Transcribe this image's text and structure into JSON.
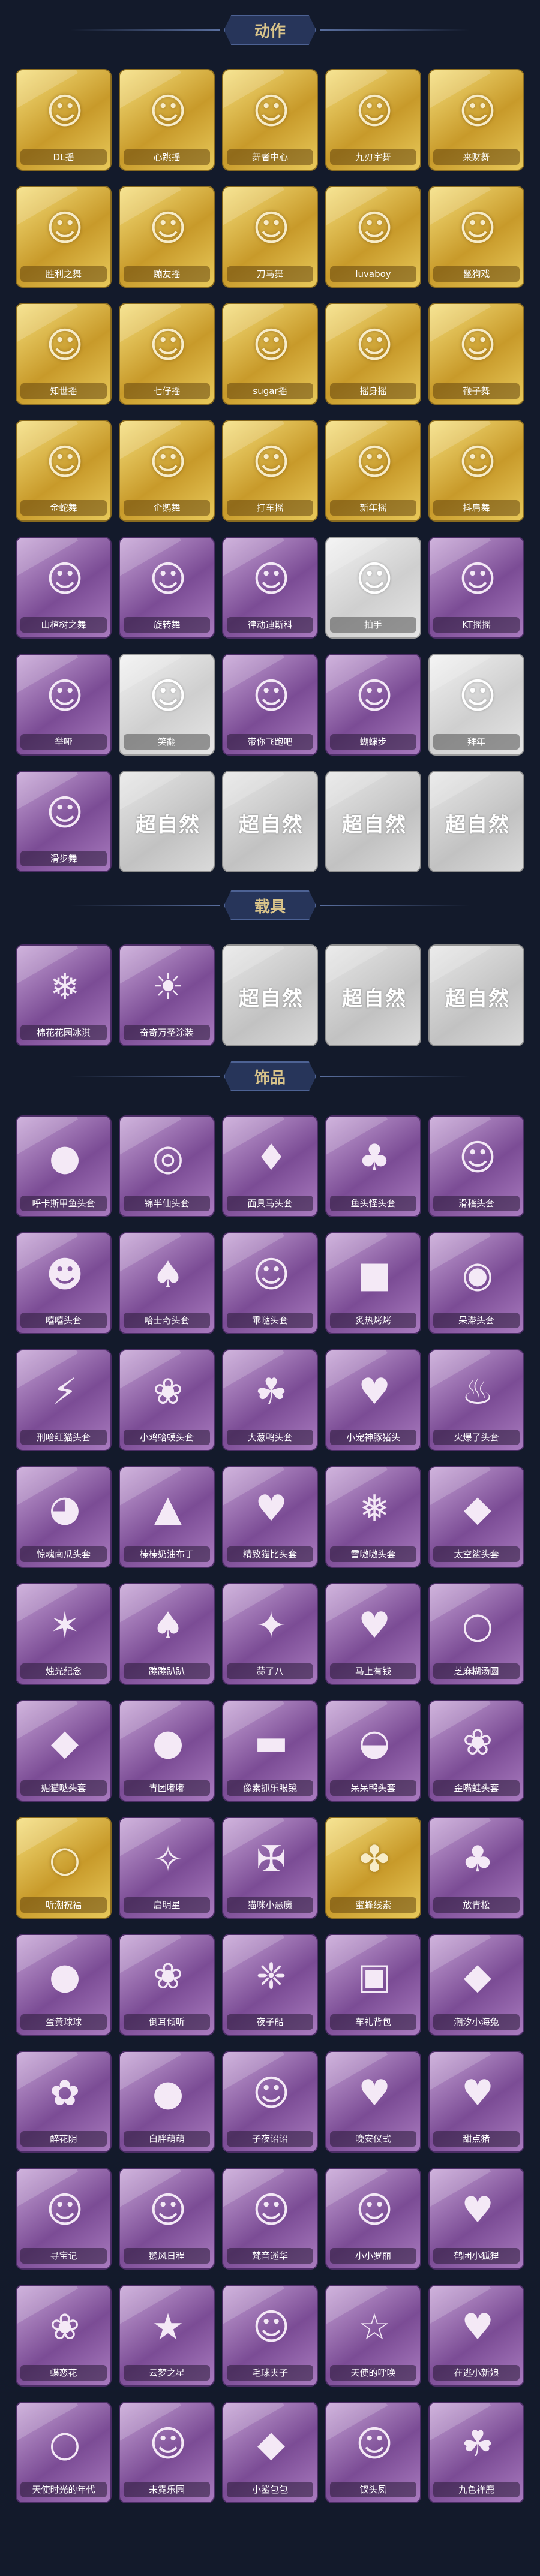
{
  "sections": [
    {
      "title": "动作",
      "items": [
        {
          "label": "DL摇",
          "style": "gold",
          "icon": "dance-pose-icon"
        },
        {
          "label": "心跳摇",
          "style": "gold",
          "icon": "dance-pose-icon"
        },
        {
          "label": "舞者中心",
          "style": "gold",
          "icon": "dance-pose-icon"
        },
        {
          "label": "九刃宇舞",
          "style": "gold",
          "icon": "dance-pose-icon"
        },
        {
          "label": "来财舞",
          "style": "gold",
          "icon": "dance-pose-icon"
        },
        {
          "label": "胜利之舞",
          "style": "gold",
          "icon": "dance-pose-icon"
        },
        {
          "label": "蹦友摇",
          "style": "gold",
          "icon": "dance-pose-icon"
        },
        {
          "label": "刀马舞",
          "style": "gold",
          "icon": "dance-pose-icon"
        },
        {
          "label": "luvaboy",
          "style": "gold",
          "icon": "dance-pose-icon"
        },
        {
          "label": "鬣狗戏",
          "style": "gold",
          "icon": "dance-pose-icon"
        },
        {
          "label": "知世摇",
          "style": "gold",
          "icon": "dance-pose-icon"
        },
        {
          "label": "七仔摇",
          "style": "gold",
          "icon": "dance-pose-icon"
        },
        {
          "label": "sugar摇",
          "style": "gold",
          "icon": "dance-pose-icon"
        },
        {
          "label": "摇身摇",
          "style": "gold",
          "icon": "dance-pose-icon"
        },
        {
          "label": "鞭子舞",
          "style": "gold",
          "icon": "dance-pose-icon"
        },
        {
          "label": "金蛇舞",
          "style": "gold",
          "icon": "dance-pose-icon"
        },
        {
          "label": "企鹅舞",
          "style": "gold",
          "icon": "dance-pose-icon"
        },
        {
          "label": "打车摇",
          "style": "gold",
          "icon": "dance-pose-icon"
        },
        {
          "label": "新年摇",
          "style": "gold",
          "icon": "dance-pose-icon"
        },
        {
          "label": "抖肩舞",
          "style": "gold",
          "icon": "dance-pose-icon"
        },
        {
          "label": "山楂树之舞",
          "style": "purple",
          "icon": "dance-pose-icon"
        },
        {
          "label": "旋转舞",
          "style": "purple",
          "icon": "dance-pose-icon"
        },
        {
          "label": "律动迪斯科",
          "style": "purple",
          "icon": "dance-pose-icon"
        },
        {
          "label": "拍手",
          "style": "gray",
          "icon": "dance-pose-icon"
        },
        {
          "label": "KT摇摇",
          "style": "purple",
          "icon": "dance-pose-icon"
        },
        {
          "label": "举哑",
          "style": "purple",
          "icon": "dance-pose-icon"
        },
        {
          "label": "笑翻",
          "style": "gray",
          "icon": "dance-pose-icon"
        },
        {
          "label": "带你飞跑吧",
          "style": "purple",
          "icon": "dance-pose-icon"
        },
        {
          "label": "蝴蝶步",
          "style": "purple",
          "icon": "dance-pose-icon"
        },
        {
          "label": "拜年",
          "style": "gray",
          "icon": "dance-pose-icon"
        },
        {
          "label": "滑步舞",
          "style": "purple",
          "icon": "dance-pose-icon"
        },
        {
          "label": "",
          "style": "placeholder",
          "icon": "logo-placeholder-icon"
        },
        {
          "label": "",
          "style": "placeholder",
          "icon": "logo-placeholder-icon"
        },
        {
          "label": "",
          "style": "placeholder",
          "icon": "logo-placeholder-icon"
        },
        {
          "label": "",
          "style": "placeholder",
          "icon": "logo-placeholder-icon"
        }
      ]
    },
    {
      "title": "载具",
      "items": [
        {
          "label": "棉花花园冰淇",
          "style": "purple",
          "icon": "ice-cream-truck-icon"
        },
        {
          "label": "奋奇万圣涂装",
          "style": "purple",
          "icon": "food-truck-icon"
        },
        {
          "label": "",
          "style": "placeholder",
          "icon": "logo-placeholder-icon"
        },
        {
          "label": "",
          "style": "placeholder",
          "icon": "logo-placeholder-icon"
        },
        {
          "label": "",
          "style": "placeholder",
          "icon": "logo-placeholder-icon"
        }
      ]
    },
    {
      "title": "饰品",
      "items": [
        {
          "label": "呼卡斯甲鱼头套",
          "style": "purple",
          "icon": "fish-head-icon"
        },
        {
          "label": "锦半仙头套",
          "style": "purple",
          "icon": "panda-head-icon"
        },
        {
          "label": "面具马头套",
          "style": "purple",
          "icon": "horse-head-icon"
        },
        {
          "label": "鱼头怪头套",
          "style": "purple",
          "icon": "fish-monster-icon"
        },
        {
          "label": "滑稽头套",
          "style": "purple",
          "icon": "smiley-icon"
        },
        {
          "label": "嘻嘻头套",
          "style": "purple",
          "icon": "grin-icon"
        },
        {
          "label": "哈士奇头套",
          "style": "purple",
          "icon": "husky-head-icon"
        },
        {
          "label": "乖哒头套",
          "style": "purple",
          "icon": "smiley-icon"
        },
        {
          "label": "炙热烤烤",
          "style": "purple",
          "icon": "monster-head-icon"
        },
        {
          "label": "呆滞头套",
          "style": "purple",
          "icon": "stare-face-icon"
        },
        {
          "label": "刑哈红猫头套",
          "style": "purple",
          "icon": "pikachu-head-icon"
        },
        {
          "label": "小鸡蛤蟆头套",
          "style": "purple",
          "icon": "frog-head-icon"
        },
        {
          "label": "大葱鸭头套",
          "style": "purple",
          "icon": "green-onion-icon"
        },
        {
          "label": "小宠神豚猪头",
          "style": "purple",
          "icon": "pig-head-icon"
        },
        {
          "label": "火爆了头套",
          "style": "purple",
          "icon": "flame-head-icon"
        },
        {
          "label": "惊魂南瓜头套",
          "style": "purple",
          "icon": "pumpkin-head-icon"
        },
        {
          "label": "榛榛奶油布丁",
          "style": "purple",
          "icon": "pudding-icon"
        },
        {
          "label": "精致猫比头套",
          "style": "purple",
          "icon": "pink-creature-icon"
        },
        {
          "label": "雪嗷嗷头套",
          "style": "purple",
          "icon": "snow-creature-icon"
        },
        {
          "label": "太空鲨头套",
          "style": "purple",
          "icon": "shark-head-icon"
        },
        {
          "label": "烛光纪念",
          "style": "purple",
          "icon": "candle-icon"
        },
        {
          "label": "蹦蹦趴趴",
          "style": "purple",
          "icon": "dog-head-icon"
        },
        {
          "label": "蒜了八",
          "style": "purple",
          "icon": "garlic-head-icon"
        },
        {
          "label": "马上有钱",
          "style": "purple",
          "icon": "pink-horse-icon"
        },
        {
          "label": "芝麻糊汤圆",
          "style": "purple",
          "icon": "dumpling-icon"
        },
        {
          "label": "媚猫哒头套",
          "style": "purple",
          "icon": "cat-head-icon"
        },
        {
          "label": "青团嘟嘟",
          "style": "purple",
          "icon": "green-bun-icon"
        },
        {
          "label": "像素抓乐眼镜",
          "style": "purple",
          "icon": "pixel-glasses-icon"
        },
        {
          "label": "呆呆鸭头套",
          "style": "purple",
          "icon": "duck-head-icon"
        },
        {
          "label": "歪嘴蛙头套",
          "style": "purple",
          "icon": "frog-head-icon"
        },
        {
          "label": "听潮祝福",
          "style": "gold",
          "icon": "halo-icon"
        },
        {
          "label": "启明星",
          "style": "purple",
          "icon": "hair-accessory-icon"
        },
        {
          "label": "猫咪小恶魔",
          "style": "purple",
          "icon": "devil-horns-icon"
        },
        {
          "label": "蜜蜂线索",
          "style": "gold",
          "icon": "bee-antenna-icon"
        },
        {
          "label": "放青松",
          "style": "purple",
          "icon": "pine-tree-icon"
        },
        {
          "label": "蛋黄球球",
          "style": "purple",
          "icon": "chick-icon"
        },
        {
          "label": "倒耳倾听",
          "style": "purple",
          "icon": "bunny-ear-icon"
        },
        {
          "label": "夜子船",
          "style": "purple",
          "icon": "crystal-icon"
        },
        {
          "label": "车礼背包",
          "style": "purple",
          "icon": "backpack-icon"
        },
        {
          "label": "潮汐小海兔",
          "style": "purple",
          "icon": "blue-cat-icon"
        },
        {
          "label": "醉花阴",
          "style": "purple",
          "icon": "flower-crown-icon"
        },
        {
          "label": "白胖萌萌",
          "style": "purple",
          "icon": "white-plush-icon"
        },
        {
          "label": "子夜诏诏",
          "style": "purple",
          "icon": "doll-icon"
        },
        {
          "label": "晚安仪式",
          "style": "purple",
          "icon": "pig-plush-icon"
        },
        {
          "label": "甜点猪",
          "style": "purple",
          "icon": "pink-bear-icon"
        },
        {
          "label": "寻宝记",
          "style": "purple",
          "icon": "pink-doll-icon"
        },
        {
          "label": "鹅风日程",
          "style": "purple",
          "icon": "cap-doll-icon"
        },
        {
          "label": "梵音遥华",
          "style": "purple",
          "icon": "pink-girl-icon"
        },
        {
          "label": "小小罗丽",
          "style": "purple",
          "icon": "red-doll-icon"
        },
        {
          "label": "鹤团小狐狸",
          "style": "purple",
          "icon": "red-fox-icon"
        },
        {
          "label": "蝶恋花",
          "style": "purple",
          "icon": "butterfly-staff-icon"
        },
        {
          "label": "云梦之星",
          "style": "purple",
          "icon": "unicorn-icon"
        },
        {
          "label": "毛球夹子",
          "style": "purple",
          "icon": "hat-doll-icon"
        },
        {
          "label": "天使的呼唤",
          "style": "purple",
          "icon": "angel-doll-icon"
        },
        {
          "label": "在逃小新娘",
          "style": "purple",
          "icon": "red-bride-icon"
        },
        {
          "label": "天使时光的年代",
          "style": "purple",
          "icon": "mirror-icon"
        },
        {
          "label": "未霓乐园",
          "style": "purple",
          "icon": "pink-hair-doll-icon"
        },
        {
          "label": "小鲨包包",
          "style": "purple",
          "icon": "shark-bag-icon"
        },
        {
          "label": "钗头凤",
          "style": "purple",
          "icon": "hanfu-doll-icon"
        },
        {
          "label": "九色祥鹿",
          "style": "purple",
          "icon": "deer-icon"
        }
      ]
    }
  ],
  "placeholder_logo": "超自然",
  "colors": {
    "background": "#131a2b",
    "gold_tile": "#e2c256",
    "purple_tile": "#9b6db3",
    "gray_tile": "#d9d9d9",
    "header_text": "#d9c48a"
  }
}
